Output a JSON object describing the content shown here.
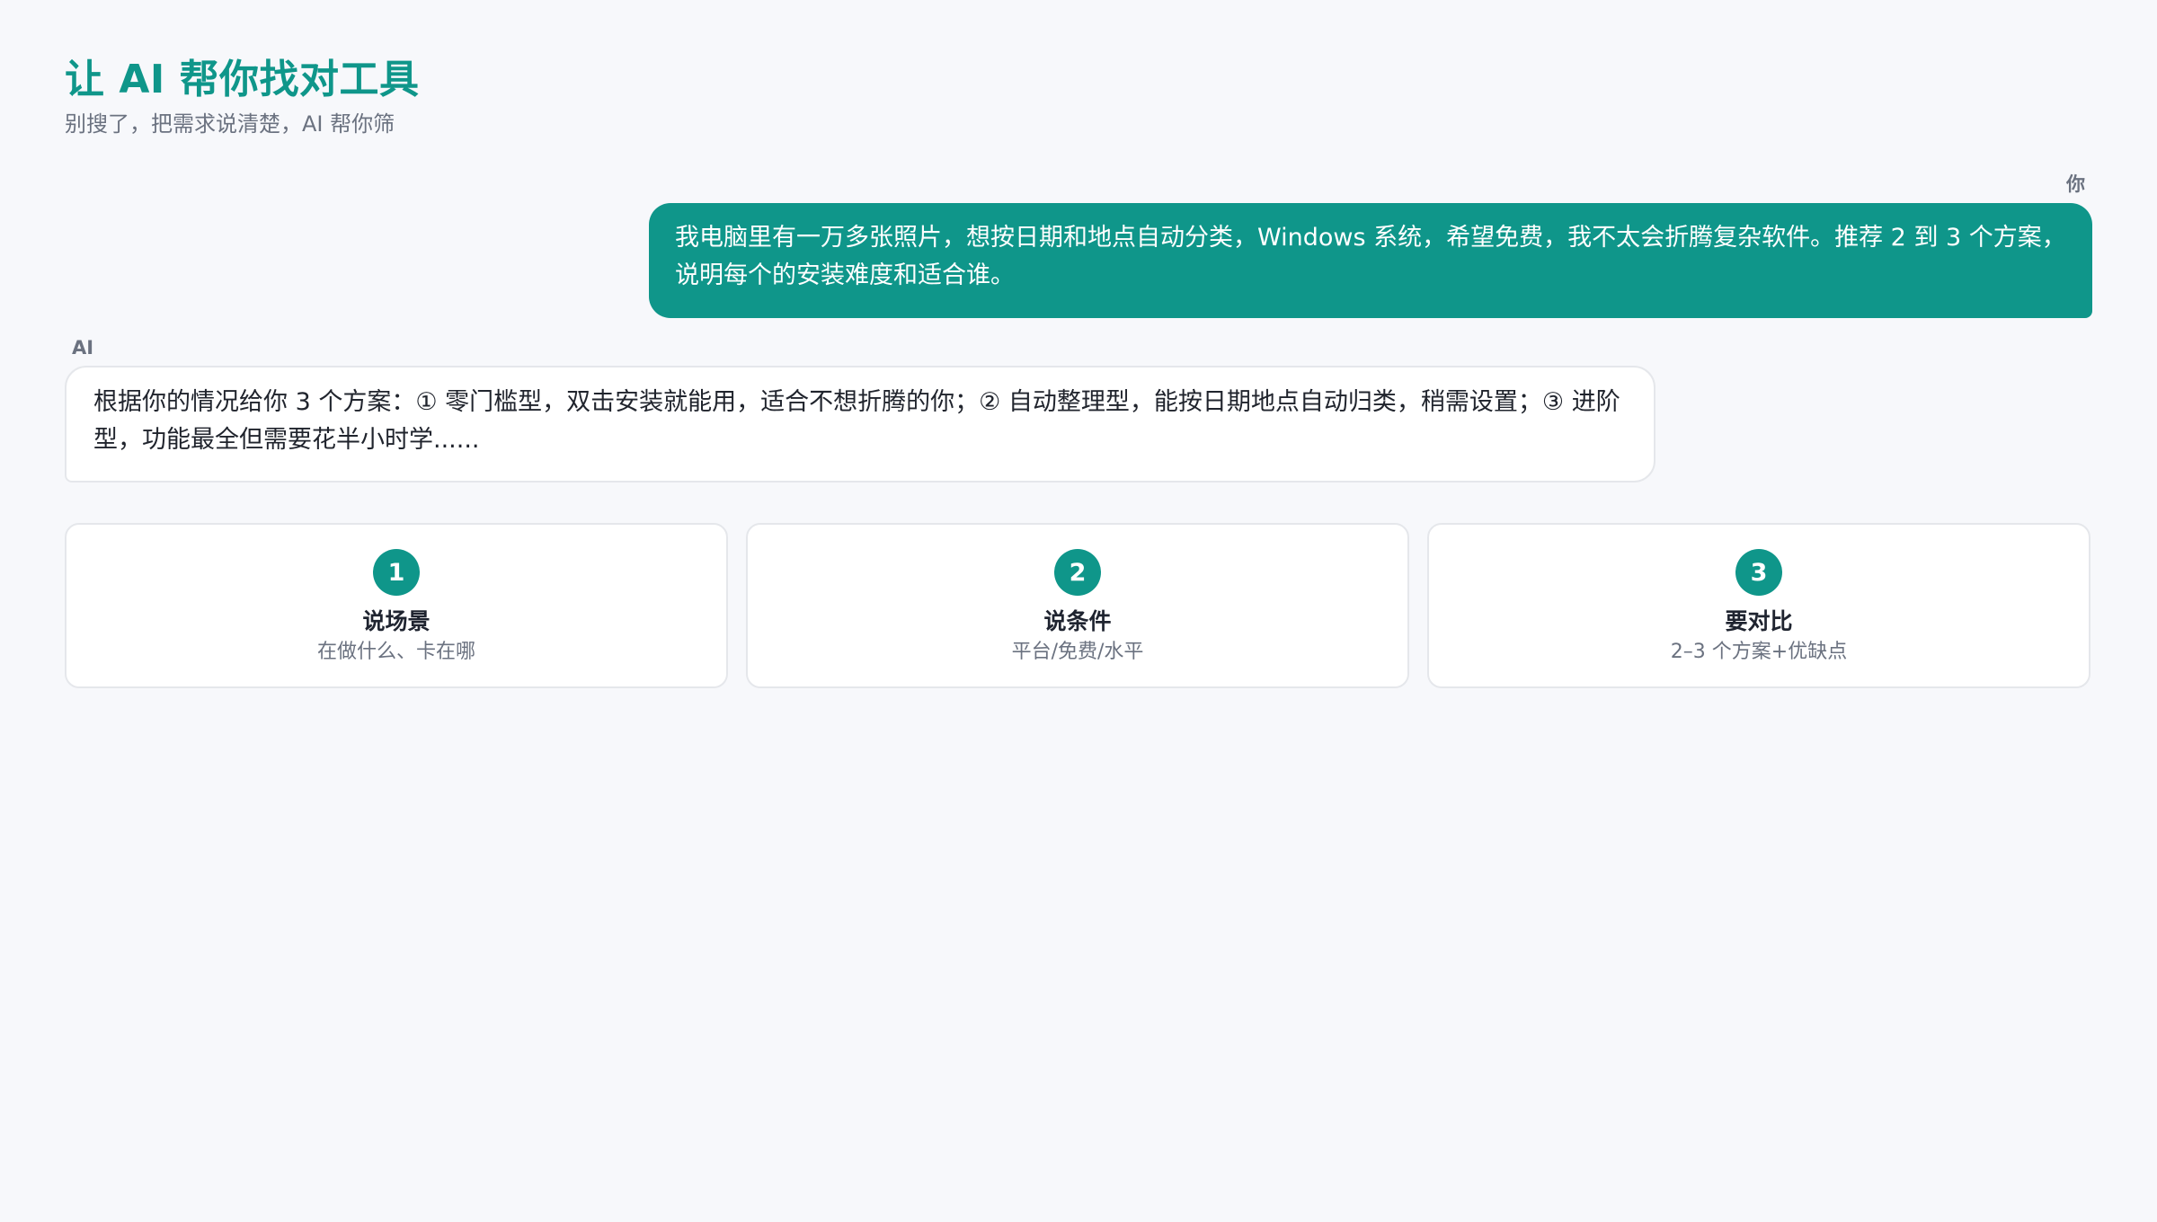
{
  "header": {
    "title": "让 AI 帮你找对工具",
    "subtitle": "别搜了，把需求说清楚，AI 帮你筛"
  },
  "conversation": {
    "user": {
      "speaker": "你",
      "message": "我电脑里有一万多张照片，想按日期和地点自动分类，Windows 系统，希望免费，我不太会折腾复杂软件。推荐 2 到 3 个方案，说明每个的安装难度和适合谁。"
    },
    "ai": {
      "speaker": "AI",
      "message": "根据你的情况给你 3 个方案：① 零门槛型，双击安装就能用，适合不想折腾的你；② 自动整理型，能按日期地点自动归类，稍需设置；③ 进阶型，功能最全但需要花半小时学......"
    }
  },
  "steps": [
    {
      "number": "1",
      "title": "说场景",
      "description": "在做什么、卡在哪"
    },
    {
      "number": "2",
      "title": "说条件",
      "description": "平台/免费/水平"
    },
    {
      "number": "3",
      "title": "要对比",
      "description": "2–3 个方案+优缺点"
    }
  ],
  "colors": {
    "accent": "#0f968a",
    "background": "#f7f8fb",
    "card": "#ffffff",
    "border": "#e5e7eb",
    "muted_text": "#6b7280"
  }
}
